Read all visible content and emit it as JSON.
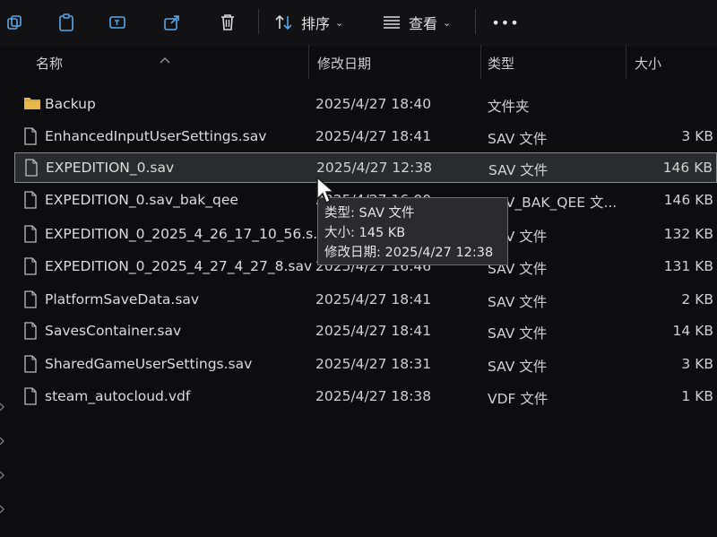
{
  "toolbar": {
    "sort_label": "排序",
    "view_label": "查看",
    "more_label": "•••"
  },
  "columns": {
    "name": "名称",
    "date": "修改日期",
    "type": "类型",
    "size": "大小"
  },
  "files": [
    {
      "name": "Backup",
      "date": "2025/4/27 18:40",
      "type": "文件夹",
      "size": "",
      "icon": "folder-icon"
    },
    {
      "name": "EnhancedInputUserSettings.sav",
      "date": "2025/4/27 18:41",
      "type": "SAV 文件",
      "size": "3 KB",
      "icon": "file-icon"
    },
    {
      "name": "EXPEDITION_0.sav",
      "date": "2025/4/27 12:38",
      "type": "SAV 文件",
      "size": "146 KB",
      "icon": "file-icon",
      "selected": true
    },
    {
      "name": "EXPEDITION_0.sav_bak_qee",
      "date": "2025/4/27 16:00",
      "type": "SAV_BAK_QEE 文...",
      "size": "146 KB",
      "icon": "file-icon"
    },
    {
      "name": "EXPEDITION_0_2025_4_26_17_10_56.s...",
      "date": "",
      "type": "SAV 文件",
      "size": "132 KB",
      "icon": "file-icon"
    },
    {
      "name": "EXPEDITION_0_2025_4_27_4_27_8.sav",
      "date": "2025/4/27 16:46",
      "type": "SAV 文件",
      "size": "131 KB",
      "icon": "file-icon"
    },
    {
      "name": "PlatformSaveData.sav",
      "date": "2025/4/27 18:41",
      "type": "SAV 文件",
      "size": "2 KB",
      "icon": "file-icon"
    },
    {
      "name": "SavesContainer.sav",
      "date": "2025/4/27 18:41",
      "type": "SAV 文件",
      "size": "14 KB",
      "icon": "file-icon"
    },
    {
      "name": "SharedGameUserSettings.sav",
      "date": "2025/4/27 18:31",
      "type": "SAV 文件",
      "size": "3 KB",
      "icon": "file-icon"
    },
    {
      "name": "steam_autocloud.vdf",
      "date": "2025/4/27 18:38",
      "type": "VDF 文件",
      "size": "1 KB",
      "icon": "file-icon"
    }
  ],
  "tooltip": {
    "line_type": "类型: SAV 文件",
    "line_size": "大小: 145 KB",
    "line_date": "修改日期: 2025/4/27 12:38"
  },
  "colors": {
    "background": "#0d0d0f",
    "selection": "#2a2b2e",
    "folder": "#e8b84a",
    "text": "#d6d6d6"
  }
}
